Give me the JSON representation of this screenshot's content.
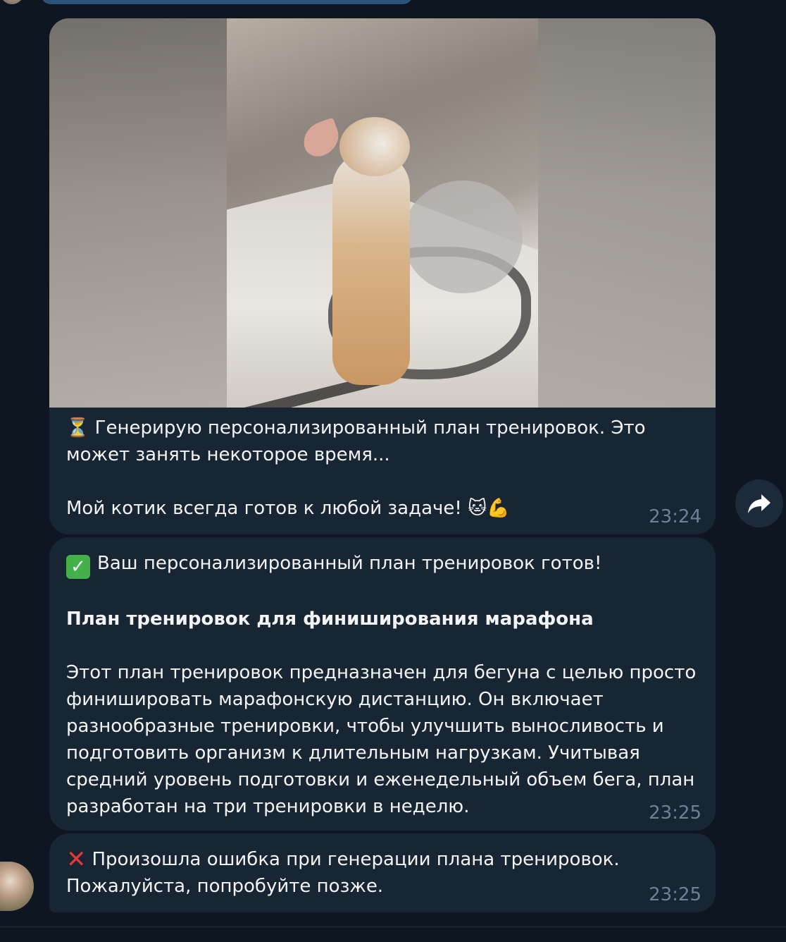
{
  "messages": [
    {
      "id": "m1",
      "has_media": true,
      "media_icon": "kitten-video-frame",
      "line1": "⏳ Генерирую персонализированный план тренировок. Это",
      "line2": "может занять некоторое время...",
      "line3": "Мой котик всегда готов к любой задаче! 🐱💪",
      "time": "23:24"
    },
    {
      "id": "m2",
      "line1": "Ваш персонализированный план тренировок готов!",
      "title": "План тренировок для финиширования марафона",
      "body": [
        "Этот план тренировок предназначен для бегуна с целью просто",
        "финишировать марафонскую дистанцию. Он включает",
        "разнообразные тренировки, чтобы улучшить выносливость и",
        "подготовить организм к длительным нагрузкам. Учитывая",
        "средний уровень подготовки и еженедельный объем бега, план",
        "разработан на три тренировки в неделю."
      ],
      "time": "23:25"
    },
    {
      "id": "m3",
      "line1": "Произошла ошибка при генерации плана тренировок.",
      "line2": "Пожалуйста, попробуйте позже.",
      "time": "23:25"
    }
  ],
  "icons": {
    "forward": "forward-arrow-icon",
    "check": "check-mark-icon",
    "error": "cross-mark-icon"
  },
  "colors": {
    "background": "#0e1621",
    "bubble": "#182533",
    "time": "#6d8196",
    "outgoing_accent": "#2b5278"
  }
}
